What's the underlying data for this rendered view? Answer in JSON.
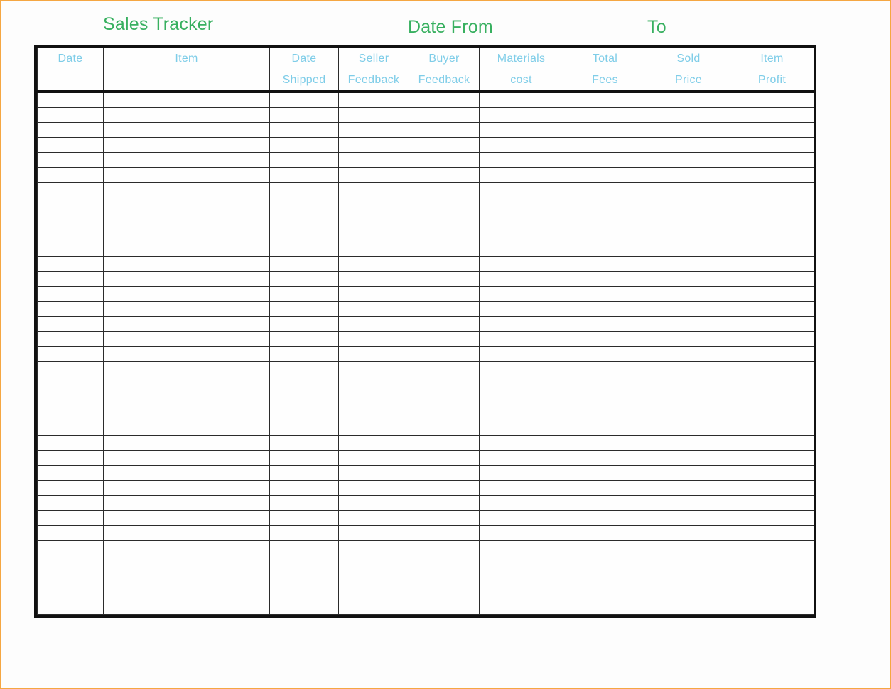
{
  "page": {
    "border_color": "#F5A742",
    "background": "#FDFDFD"
  },
  "header": {
    "title": "Sales Tracker",
    "date_from_label": "Date From",
    "date_to_label": "To",
    "title_color": "#38B060"
  },
  "table": {
    "header_text_color": "#7FCDE8",
    "grid_line_color": "#2b2b2b",
    "outer_border_color": "#111111",
    "columns": [
      {
        "top": "Date",
        "bottom": ""
      },
      {
        "top": "Item",
        "bottom": ""
      },
      {
        "top": "Date",
        "bottom": "Shipped"
      },
      {
        "top": "Seller",
        "bottom": "Feedback"
      },
      {
        "top": "Buyer",
        "bottom": "Feedback"
      },
      {
        "top": "Materials",
        "bottom": "cost"
      },
      {
        "top": "Total",
        "bottom": "Fees"
      },
      {
        "top": "Sold",
        "bottom": "Price"
      },
      {
        "top": "Item",
        "bottom": "Profit"
      }
    ],
    "body_row_count": 35,
    "rows": [
      [
        "",
        "",
        "",
        "",
        "",
        "",
        "",
        "",
        ""
      ],
      [
        "",
        "",
        "",
        "",
        "",
        "",
        "",
        "",
        ""
      ],
      [
        "",
        "",
        "",
        "",
        "",
        "",
        "",
        "",
        ""
      ],
      [
        "",
        "",
        "",
        "",
        "",
        "",
        "",
        "",
        ""
      ],
      [
        "",
        "",
        "",
        "",
        "",
        "",
        "",
        "",
        ""
      ],
      [
        "",
        "",
        "",
        "",
        "",
        "",
        "",
        "",
        ""
      ],
      [
        "",
        "",
        "",
        "",
        "",
        "",
        "",
        "",
        ""
      ],
      [
        "",
        "",
        "",
        "",
        "",
        "",
        "",
        "",
        ""
      ],
      [
        "",
        "",
        "",
        "",
        "",
        "",
        "",
        "",
        ""
      ],
      [
        "",
        "",
        "",
        "",
        "",
        "",
        "",
        "",
        ""
      ],
      [
        "",
        "",
        "",
        "",
        "",
        "",
        "",
        "",
        ""
      ],
      [
        "",
        "",
        "",
        "",
        "",
        "",
        "",
        "",
        ""
      ],
      [
        "",
        "",
        "",
        "",
        "",
        "",
        "",
        "",
        ""
      ],
      [
        "",
        "",
        "",
        "",
        "",
        "",
        "",
        "",
        ""
      ],
      [
        "",
        "",
        "",
        "",
        "",
        "",
        "",
        "",
        ""
      ],
      [
        "",
        "",
        "",
        "",
        "",
        "",
        "",
        "",
        ""
      ],
      [
        "",
        "",
        "",
        "",
        "",
        "",
        "",
        "",
        ""
      ],
      [
        "",
        "",
        "",
        "",
        "",
        "",
        "",
        "",
        ""
      ],
      [
        "",
        "",
        "",
        "",
        "",
        "",
        "",
        "",
        ""
      ],
      [
        "",
        "",
        "",
        "",
        "",
        "",
        "",
        "",
        ""
      ],
      [
        "",
        "",
        "",
        "",
        "",
        "",
        "",
        "",
        ""
      ],
      [
        "",
        "",
        "",
        "",
        "",
        "",
        "",
        "",
        ""
      ],
      [
        "",
        "",
        "",
        "",
        "",
        "",
        "",
        "",
        ""
      ],
      [
        "",
        "",
        "",
        "",
        "",
        "",
        "",
        "",
        ""
      ],
      [
        "",
        "",
        "",
        "",
        "",
        "",
        "",
        "",
        ""
      ],
      [
        "",
        "",
        "",
        "",
        "",
        "",
        "",
        "",
        ""
      ],
      [
        "",
        "",
        "",
        "",
        "",
        "",
        "",
        "",
        ""
      ],
      [
        "",
        "",
        "",
        "",
        "",
        "",
        "",
        "",
        ""
      ],
      [
        "",
        "",
        "",
        "",
        "",
        "",
        "",
        "",
        ""
      ],
      [
        "",
        "",
        "",
        "",
        "",
        "",
        "",
        "",
        ""
      ],
      [
        "",
        "",
        "",
        "",
        "",
        "",
        "",
        "",
        ""
      ],
      [
        "",
        "",
        "",
        "",
        "",
        "",
        "",
        "",
        ""
      ],
      [
        "",
        "",
        "",
        "",
        "",
        "",
        "",
        "",
        ""
      ],
      [
        "",
        "",
        "",
        "",
        "",
        "",
        "",
        "",
        ""
      ],
      [
        "",
        "",
        "",
        "",
        "",
        "",
        "",
        "",
        ""
      ]
    ]
  }
}
